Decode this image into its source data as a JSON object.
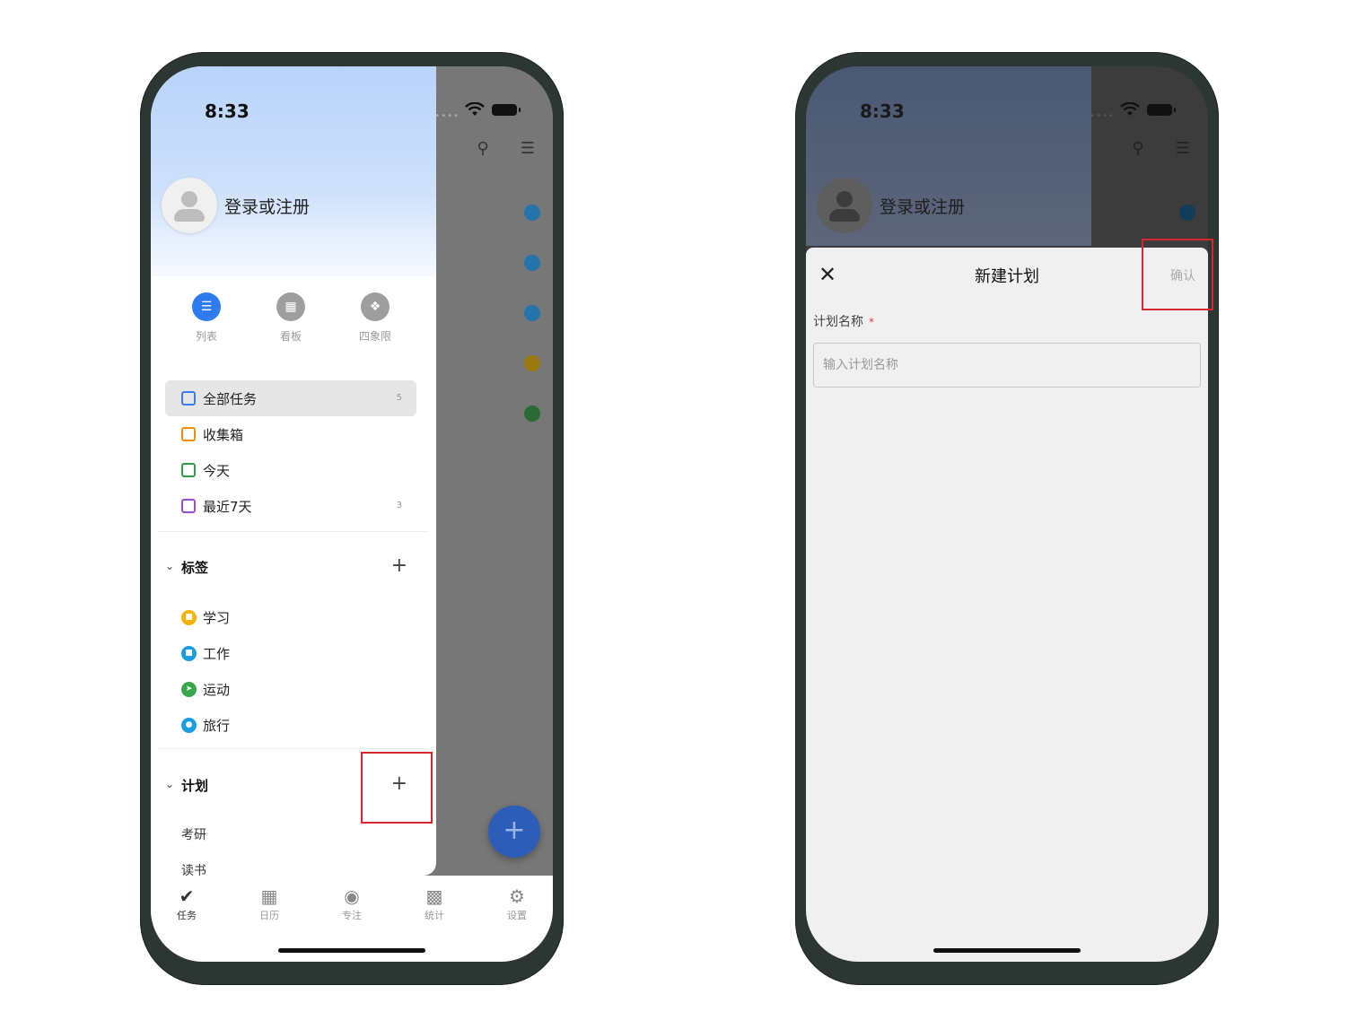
{
  "status": {
    "time": "8:33"
  },
  "drawer": {
    "login_text": "登录或注册",
    "views": [
      {
        "label": "列表",
        "icon": "list-icon",
        "active": true
      },
      {
        "label": "看板",
        "icon": "kanban-icon",
        "active": false
      },
      {
        "label": "四象限",
        "icon": "quadrant-icon",
        "active": false
      }
    ],
    "smart_lists": [
      {
        "label": "全部任务",
        "count": "5",
        "icon": "all-tasks-icon",
        "color": "#3b7ded"
      },
      {
        "label": "收集箱",
        "count": "",
        "icon": "inbox-icon",
        "color": "#f08c00"
      },
      {
        "label": "今天",
        "count": "",
        "icon": "calendar-today-icon",
        "color": "#2e9e44"
      },
      {
        "label": "最近7天",
        "count": "3",
        "icon": "calendar-week-icon",
        "color": "#9c4ccf"
      }
    ],
    "tags_section": {
      "title": "标签"
    },
    "tags": [
      {
        "label": "学习",
        "color": "#f5b400"
      },
      {
        "label": "工作",
        "color": "#1a9de0"
      },
      {
        "label": "运动",
        "color": "#38a64a"
      },
      {
        "label": "旅行",
        "color": "#1a9de0"
      }
    ],
    "plans_section": {
      "title": "计划"
    },
    "plans": [
      "考研",
      "读书"
    ]
  },
  "tabbar": [
    {
      "label": "任务",
      "icon": "check-icon",
      "active": true
    },
    {
      "label": "日历",
      "icon": "calendar-icon",
      "active": false
    },
    {
      "label": "专注",
      "icon": "focus-icon",
      "active": false
    },
    {
      "label": "统计",
      "icon": "stats-icon",
      "active": false
    },
    {
      "label": "设置",
      "icon": "gear-icon",
      "active": false
    }
  ],
  "new_plan_sheet": {
    "title": "新建计划",
    "confirm_label": "确认",
    "field_label": "计划名称",
    "required_mark": "*",
    "placeholder": "输入计划名称",
    "value": ""
  },
  "colors": {
    "accent": "#2e7bf0",
    "fab": "#2c5db8",
    "highlight_box": "#d9262c"
  }
}
